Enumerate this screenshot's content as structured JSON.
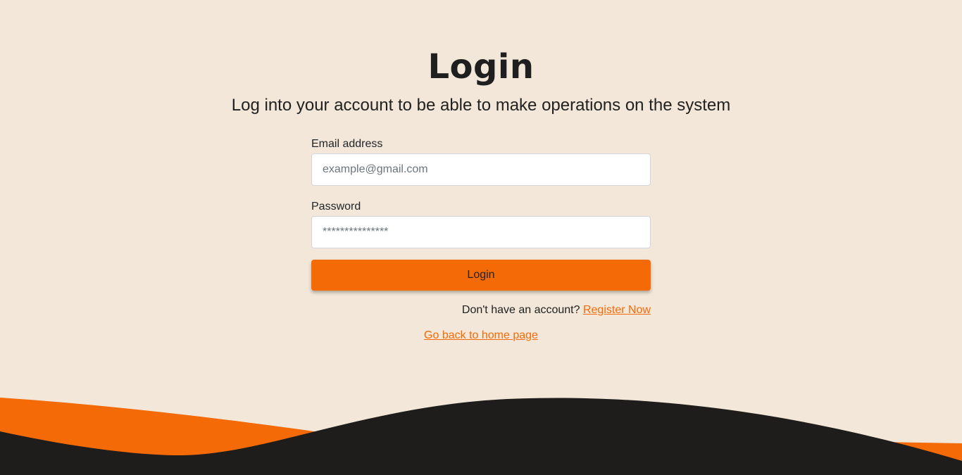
{
  "header": {
    "title": "Login",
    "subtitle": "Log into your account to be able to make operations on the system"
  },
  "form": {
    "email": {
      "label": "Email address",
      "placeholder": "example@gmail.com",
      "value": ""
    },
    "password": {
      "label": "Password",
      "placeholder": "***************",
      "value": ""
    },
    "submit_label": "Login",
    "register_prompt": "Don't have an account?",
    "register_link": "Register Now"
  },
  "footer_link": "Go back to home page",
  "colors": {
    "background": "#f2e7d8",
    "accent": "#f46a07",
    "dark": "#1f1d1b"
  }
}
